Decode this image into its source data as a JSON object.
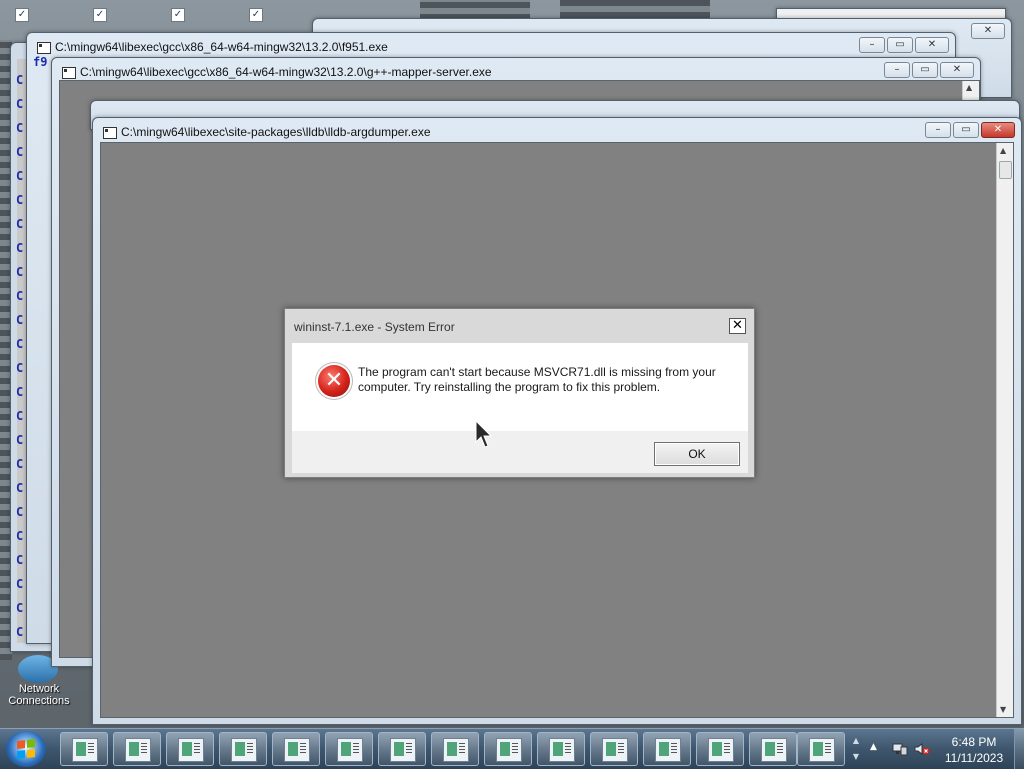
{
  "desktop": {
    "network_label": "Network\nConnections"
  },
  "windows": {
    "back_dialog": {
      "title": ""
    },
    "w1": {
      "title": "C:\\mingw64\\libexec\\gcc\\x86_64-w64-mingw32\\13.2.0\\f951.exe",
      "console_prefix": "f9"
    },
    "w2": {
      "title": "C:\\mingw64\\libexec\\gcc\\x86_64-w64-mingw32\\13.2.0\\g++-mapper-server.exe"
    },
    "w3": {
      "title": "C:\\mingw64\\libexec\\site-packages\\lldb\\lldb-argdumper.exe"
    }
  },
  "dialog": {
    "title": "wininst-7.1.exe - System Error",
    "message": "The program can't start because MSVCR71.dll is missing from your computer. Try reinstalling the program to fix this problem.",
    "ok_label": "OK",
    "close_glyph": "✕",
    "icon": "error-icon"
  },
  "taskbar": {
    "time": "6:48 PM",
    "date": "11/11/2023",
    "button_count_note": ""
  },
  "colors": {
    "client_gray": "#818181",
    "error_red": "#d3231a",
    "taskbar": "#3e566d"
  }
}
